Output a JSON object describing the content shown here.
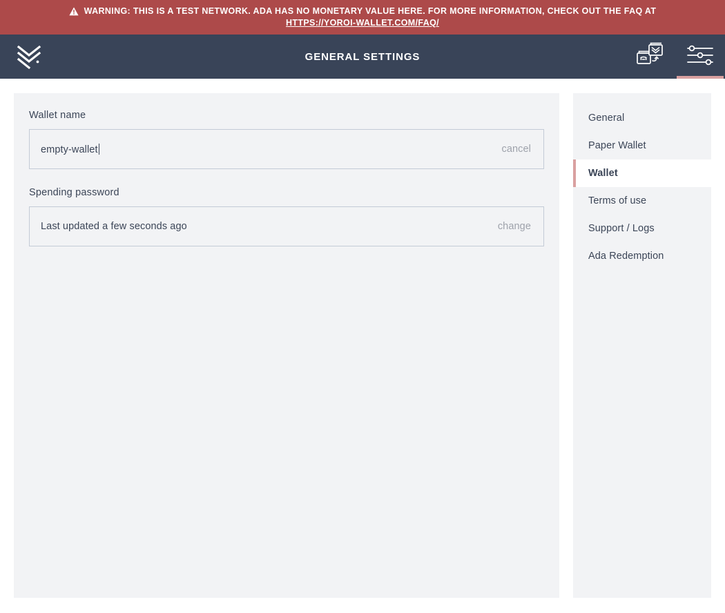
{
  "warning": {
    "icon": "warning-triangle-icon",
    "line1": "WARNING: THIS IS A TEST NETWORK. ADA HAS NO MONETARY VALUE HERE. FOR MORE INFORMATION, CHECK OUT THE FAQ AT",
    "link": "HTTPS://YOROI-WALLET.COM/FAQ/",
    "background_color": "#ad4a4a",
    "text_color": "#ffffff"
  },
  "navbar": {
    "logo": "yoroi-logo-icon",
    "title": "GENERAL SETTINGS",
    "background_color": "#394458",
    "actions": [
      {
        "name": "wallet-switch-icon",
        "label": "Change wallet",
        "active": false
      },
      {
        "name": "settings-sliders-icon",
        "label": "Settings",
        "active": true
      }
    ],
    "active_indicator_color": "#d9a0a0"
  },
  "settings": {
    "wallet_name": {
      "label": "Wallet name",
      "value": "empty-wallet",
      "placeholder": "Wallet name",
      "action_label": "cancel"
    },
    "spending_password": {
      "label": "Spending password",
      "value": "Last updated a few seconds ago",
      "action_label": "change"
    }
  },
  "menu": {
    "items": [
      {
        "label": "General",
        "active": false
      },
      {
        "label": "Paper Wallet",
        "active": false
      },
      {
        "label": "Wallet",
        "active": true
      },
      {
        "label": "Terms of use",
        "active": false
      },
      {
        "label": "Support / Logs",
        "active": false
      },
      {
        "label": "Ada Redemption",
        "active": false
      }
    ],
    "active_marker_color": "#d9a0a0"
  }
}
